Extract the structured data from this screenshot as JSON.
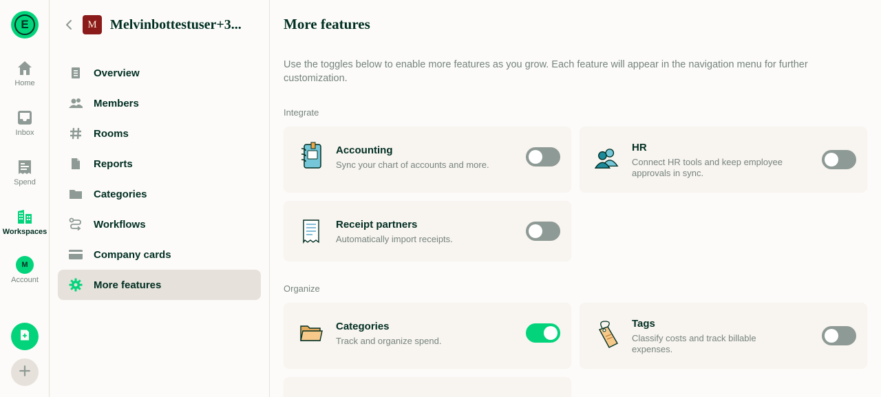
{
  "rail": {
    "logo_letter": "E",
    "items": [
      {
        "label": "Home",
        "icon": "home-icon"
      },
      {
        "label": "Inbox",
        "icon": "inbox-icon"
      },
      {
        "label": "Spend",
        "icon": "receipt-icon"
      },
      {
        "label": "Workspaces",
        "icon": "building-icon",
        "active": true
      },
      {
        "label": "Account",
        "icon": "avatar"
      }
    ],
    "account_initial": "M"
  },
  "workspace": {
    "avatar_letter": "M",
    "name": "Melvinbottestuser+3...",
    "nav": [
      {
        "label": "Overview",
        "icon": "document-icon"
      },
      {
        "label": "Members",
        "icon": "users-icon"
      },
      {
        "label": "Rooms",
        "icon": "hashtag-icon"
      },
      {
        "label": "Reports",
        "icon": "report-icon"
      },
      {
        "label": "Categories",
        "icon": "folder-icon"
      },
      {
        "label": "Workflows",
        "icon": "workflow-icon"
      },
      {
        "label": "Company cards",
        "icon": "card-icon"
      },
      {
        "label": "More features",
        "icon": "gear-icon",
        "active": true
      }
    ]
  },
  "main": {
    "title": "More features",
    "intro": "Use the toggles below to enable more features as you grow. Each feature will appear in the navigation menu for further customization.",
    "sections": [
      {
        "label": "Integrate",
        "features": [
          {
            "title": "Accounting",
            "description": "Sync your chart of accounts and more.",
            "enabled": false,
            "icon": "accounting-notebook-icon"
          },
          {
            "title": "HR",
            "description": "Connect HR tools and keep employee approvals in sync.",
            "enabled": false,
            "icon": "people-icon"
          },
          {
            "title": "Receipt partners",
            "description": "Automatically import receipts.",
            "enabled": false,
            "icon": "receipt-icon"
          }
        ]
      },
      {
        "label": "Organize",
        "features": [
          {
            "title": "Categories",
            "description": "Track and organize spend.",
            "enabled": true,
            "icon": "folder-icon"
          },
          {
            "title": "Tags",
            "description": "Classify costs and track billable expenses.",
            "enabled": false,
            "icon": "tag-icon"
          }
        ]
      }
    ]
  },
  "colors": {
    "accent_green": "#03d47c",
    "text_dark": "#002e22",
    "text_muted": "#76847e",
    "card_bg": "#f8f4f0",
    "toggle_off": "#8e9a95",
    "workspace_avatar": "#8b1a1a"
  }
}
